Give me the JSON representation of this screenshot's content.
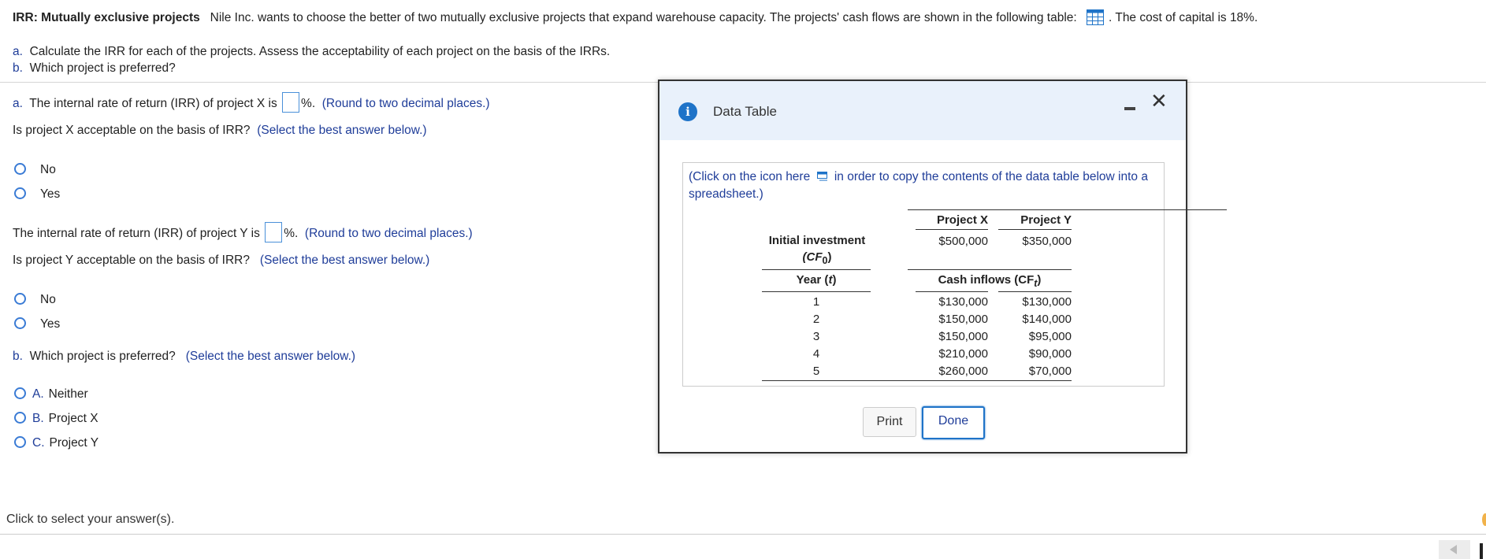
{
  "header": {
    "title": "IRR: Mutually exclusive projects",
    "description": "Nile Inc. wants to choose the better of two mutually exclusive projects that expand warehouse capacity. The projects' cash flows are shown in the following table:",
    "after_icon": ". The cost of capital is 18%."
  },
  "parts": {
    "a_letter": "a.",
    "a_text": "Calculate the IRR for each of the projects. Assess the acceptability of each project on the basis of the IRRs.",
    "b_letter": "b.",
    "b_text": "Which project is preferred?"
  },
  "q1": {
    "letter": "a.",
    "prefix": "The internal rate of return (IRR) of project X is",
    "value": "",
    "suffix": "%.",
    "hint": "(Round to two decimal places.)"
  },
  "q2": {
    "text": "Is project X acceptable on the basis of IRR?",
    "hint": "(Select the best answer below.)"
  },
  "q2_options": [
    "No",
    "Yes"
  ],
  "q3": {
    "prefix": "The internal rate of return (IRR) of project Y is",
    "value": "",
    "suffix": "%.",
    "hint": "(Round to two decimal places.)"
  },
  "q4": {
    "text": "Is project Y acceptable on the basis of IRR?",
    "hint": "(Select the best answer below.)"
  },
  "q4_options": [
    "No",
    "Yes"
  ],
  "q5": {
    "letter": "b.",
    "text": "Which project is preferred?",
    "hint": "(Select the best answer below.)"
  },
  "q5_options": [
    {
      "letter": "A.",
      "text": "Neither"
    },
    {
      "letter": "B.",
      "text": "Project X"
    },
    {
      "letter": "C.",
      "text": "Project Y"
    }
  ],
  "status": "Click to select your answer(s).",
  "dialog": {
    "title": "Data Table",
    "copy_note_1": "(Click on the icon here",
    "copy_note_2": "in order to copy the contents of the data table below into a spreadsheet.)",
    "table": {
      "col_x": "Project X",
      "col_y": "Project Y",
      "initial_label": "Initial investment",
      "initial_sub": "(CF",
      "initial_sub_idx": "0",
      "initial_sub_end": ")",
      "initial_x": "$500,000",
      "initial_y": "$350,000",
      "year_label": "Year (",
      "year_var": "t",
      "year_end": ")",
      "inflow_label": "Cash inflows (CF",
      "inflow_idx": "t",
      "inflow_end": ")",
      "rows": [
        {
          "year": "1",
          "x": "$130,000",
          "y": "$130,000"
        },
        {
          "year": "2",
          "x": "$150,000",
          "y": "$140,000"
        },
        {
          "year": "3",
          "x": "$150,000",
          "y": "$95,000"
        },
        {
          "year": "4",
          "x": "$210,000",
          "y": "$90,000"
        },
        {
          "year": "5",
          "x": "$260,000",
          "y": "$70,000"
        }
      ]
    },
    "print_label": "Print",
    "done_label": "Done"
  }
}
